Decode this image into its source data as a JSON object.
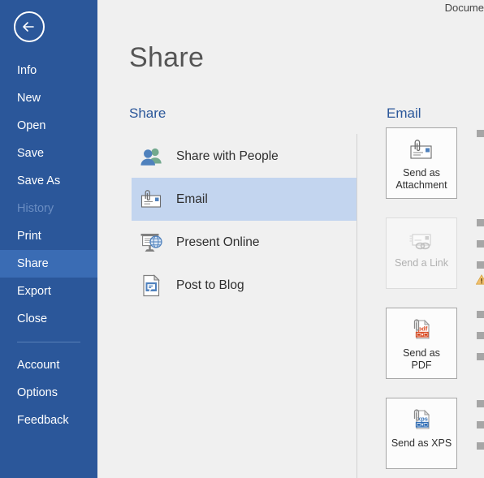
{
  "window": {
    "document_title": "Docume"
  },
  "sidebar": {
    "back_icon": "back-arrow-icon",
    "background_color": "#2b579a",
    "selected_color": "#3a6cb4",
    "items": [
      {
        "label": "Info",
        "state": "normal",
        "name": "info"
      },
      {
        "label": "New",
        "state": "normal",
        "name": "new"
      },
      {
        "label": "Open",
        "state": "normal",
        "name": "open"
      },
      {
        "label": "Save",
        "state": "normal",
        "name": "save"
      },
      {
        "label": "Save As",
        "state": "normal",
        "name": "save-as"
      },
      {
        "label": "History",
        "state": "disabled",
        "name": "history"
      },
      {
        "label": "Print",
        "state": "normal",
        "name": "print"
      },
      {
        "label": "Share",
        "state": "selected",
        "name": "share"
      },
      {
        "label": "Export",
        "state": "normal",
        "name": "export"
      },
      {
        "label": "Close",
        "state": "normal",
        "name": "close"
      },
      {
        "label": "",
        "state": "separator",
        "name": "separator"
      },
      {
        "label": "Account",
        "state": "normal",
        "name": "account"
      },
      {
        "label": "Options",
        "state": "normal",
        "name": "options"
      },
      {
        "label": "Feedback",
        "state": "normal",
        "name": "feedback"
      }
    ]
  },
  "page": {
    "title": "Share",
    "accent_color": "#2b579a"
  },
  "share_column": {
    "heading": "Share",
    "items": [
      {
        "label": "Share with People",
        "icon": "people-icon",
        "selected": false
      },
      {
        "label": "Email",
        "icon": "email-attachment-icon",
        "selected": true
      },
      {
        "label": "Present Online",
        "icon": "present-online-icon",
        "selected": false
      },
      {
        "label": "Post to Blog",
        "icon": "post-to-blog-icon",
        "selected": false
      }
    ],
    "selected_color": "#c3d5ef"
  },
  "email_column": {
    "heading": "Email",
    "buttons": [
      {
        "label": "Send as\nAttachment",
        "line1": "Send as",
        "line2": "Attachment",
        "icon": "email-attachment-icon",
        "disabled": false
      },
      {
        "label": "Send a Link",
        "line1": "Send a Link",
        "line2": "",
        "icon": "email-link-icon",
        "disabled": true
      },
      {
        "label": "Send as\nPDF",
        "line1": "Send as",
        "line2": "PDF",
        "icon": "pdf-attachment-icon",
        "disabled": false
      },
      {
        "label": "Send as XPS",
        "line1": "Send as XPS",
        "line2": "",
        "icon": "xps-attachment-icon",
        "disabled": false
      }
    ]
  },
  "edge_details": {
    "bullet_color": "#a6a6a6",
    "warning_icon": "warning-triangle-icon",
    "bullets_y": [
      160,
      270,
      296,
      322,
      383,
      409,
      435,
      493,
      519,
      545
    ]
  }
}
